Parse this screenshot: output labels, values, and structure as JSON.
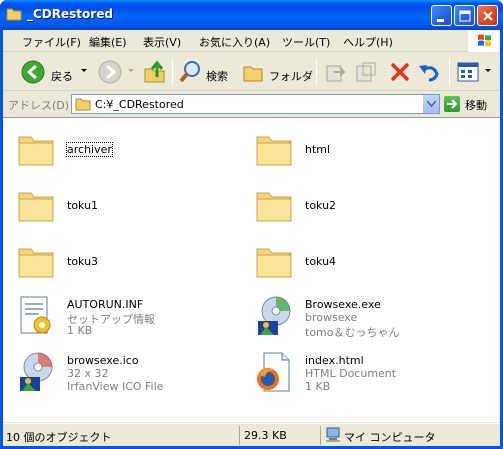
{
  "window": {
    "title": "_CDRestored"
  },
  "menubar": {
    "items": [
      {
        "label": "ファイル(F)"
      },
      {
        "label": "編集(E)"
      },
      {
        "label": "表示(V)"
      },
      {
        "label": "お気に入り(A)"
      },
      {
        "label": "ツール(T)"
      },
      {
        "label": "ヘルプ(H)"
      }
    ]
  },
  "toolbar": {
    "back_label": "戻る",
    "search_label": "検索",
    "folders_label": "フォルダ"
  },
  "address": {
    "label": "アドレス(D)",
    "value": "C:¥_CDRestored",
    "go_label": "移動"
  },
  "items": [
    {
      "name": "archiver",
      "icon": "folder-icon"
    },
    {
      "name": "html",
      "icon": "folder-icon"
    },
    {
      "name": "toku1",
      "icon": "folder-icon"
    },
    {
      "name": "toku2",
      "icon": "folder-icon"
    },
    {
      "name": "toku3",
      "icon": "folder-icon"
    },
    {
      "name": "toku4",
      "icon": "folder-icon"
    },
    {
      "name": "AUTORUN.INF",
      "line2": "セットアップ情報",
      "line3": "1 KB",
      "icon": "setup-info-icon"
    },
    {
      "name": "Browsexe.exe",
      "line2": "browsexe",
      "line3": "tomo＆むっちゃん",
      "icon": "exe-icon"
    },
    {
      "name": "browsexe.ico",
      "line2": "32 x 32",
      "line3": "IrfanView ICO File",
      "icon": "ico-file-icon"
    },
    {
      "name": "index.html",
      "line2": "HTML Document",
      "line3": "1 KB",
      "icon": "html-document-icon"
    }
  ],
  "status": {
    "objects": "10 個のオブジェクト",
    "size": "29.3 KB",
    "location": "マイ コンピュータ"
  },
  "colors": {
    "title_blue": "#0055e5",
    "folder_yellow": "#f5d57a",
    "close_red": "#d8481c"
  }
}
